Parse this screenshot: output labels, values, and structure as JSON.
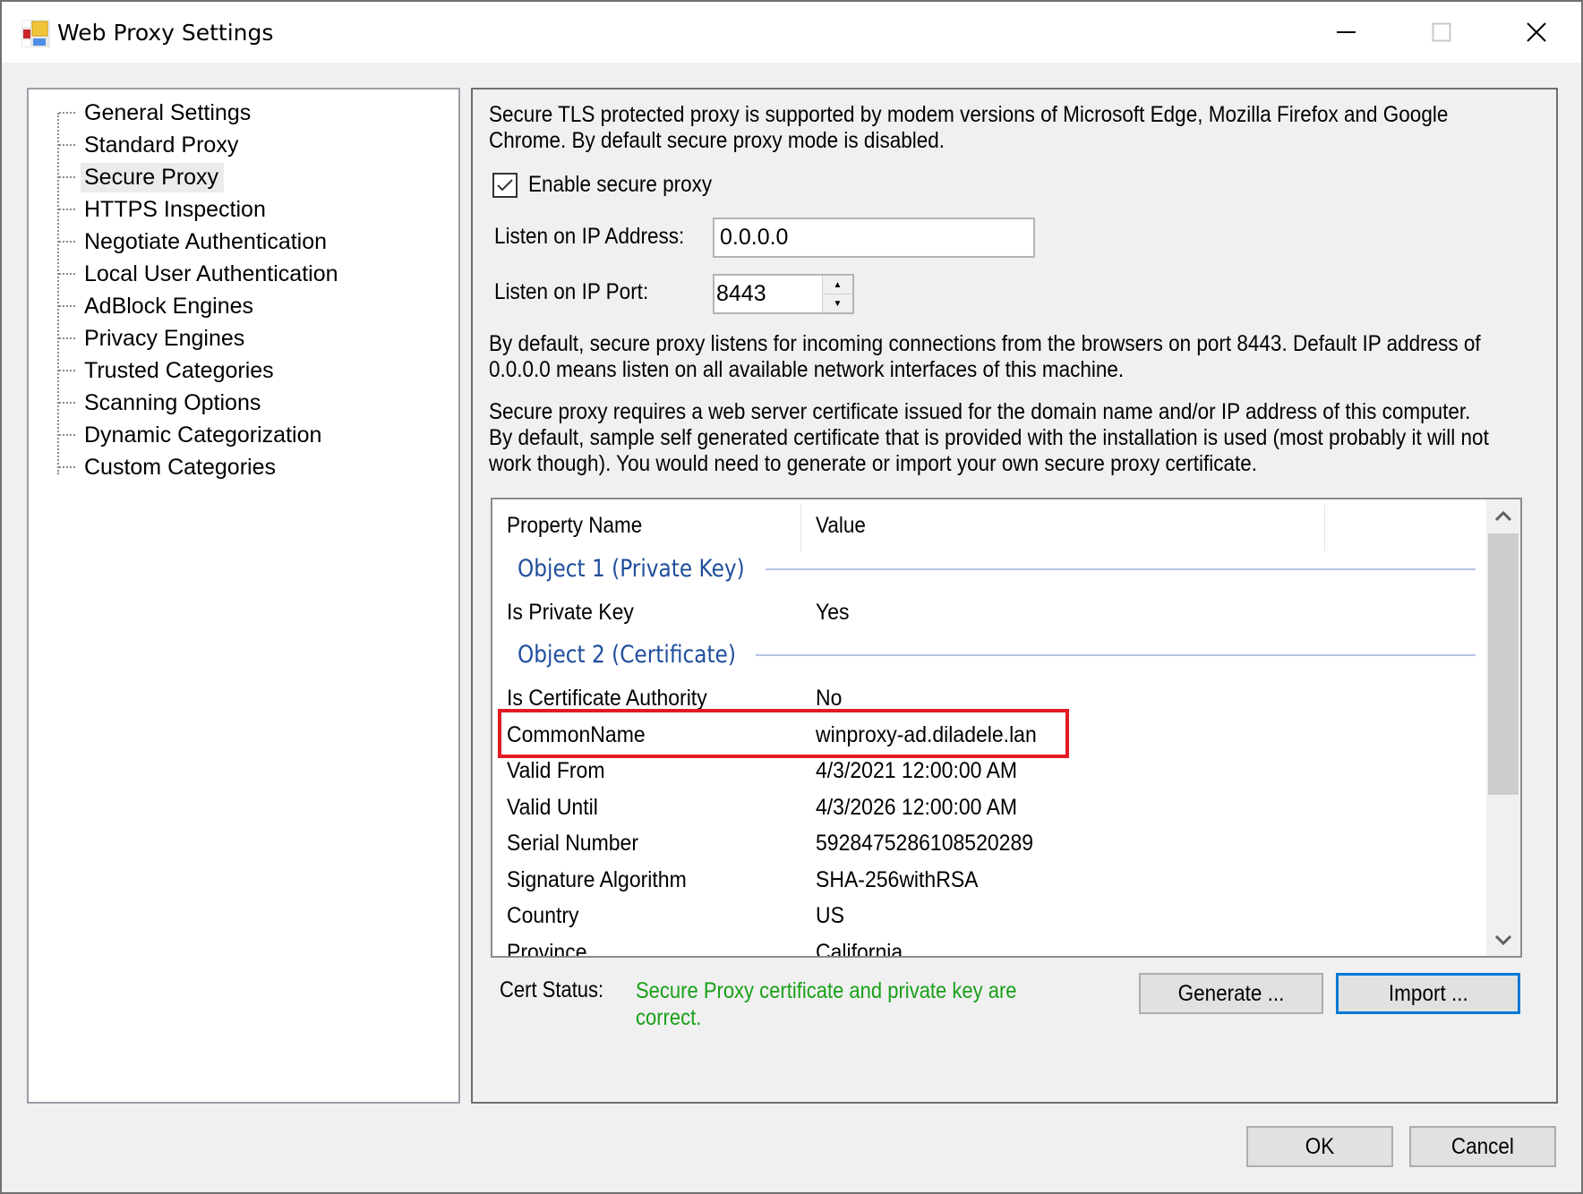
{
  "window": {
    "title": "Web Proxy Settings",
    "icon": "app-settings-icon",
    "controls": {
      "minimize": "minimize-icon",
      "maximize": "maximize-icon",
      "close": "close-icon"
    }
  },
  "sidebar": {
    "selected": "Secure Proxy",
    "items": [
      {
        "label": "General Settings"
      },
      {
        "label": "Standard Proxy"
      },
      {
        "label": "Secure Proxy"
      },
      {
        "label": "HTTPS Inspection"
      },
      {
        "label": "Negotiate Authentication"
      },
      {
        "label": "Local User Authentication"
      },
      {
        "label": "AdBlock Engines"
      },
      {
        "label": "Privacy Engines"
      },
      {
        "label": "Trusted Categories"
      },
      {
        "label": "Scanning Options"
      },
      {
        "label": "Dynamic Categorization"
      },
      {
        "label": "Custom Categories"
      }
    ]
  },
  "main": {
    "intro": [
      "Secure TLS protected proxy is supported by modem versions of Microsoft Edge, Mozilla Firefox and Google",
      "Chrome. By default secure proxy mode is disabled."
    ],
    "enable_checkbox": {
      "label": "Enable secure proxy",
      "checked": true
    },
    "ip_address": {
      "label": "Listen on IP Address:",
      "value": "0.0.0.0"
    },
    "ip_port": {
      "label": "Listen on IP Port:",
      "value": "8443"
    },
    "port_info": [
      "By default, secure proxy listens for incoming connections from the browsers on port 8443. Default IP address of",
      "0.0.0.0 means listen on all available network interfaces of this machine."
    ],
    "cert_info": [
      "Secure proxy requires a web server certificate issued for the domain name and/or IP address of this computer.",
      "By default, sample self generated certificate that is provided with the installation is used (most probably it will not",
      "work though). You would need to generate or import your own secure proxy certificate."
    ],
    "properties": {
      "columns": [
        "Property Name",
        "Value"
      ],
      "groups": [
        {
          "title": "Object 1 (Private Key)",
          "rows": [
            {
              "name": "Is Private Key",
              "value": "Yes"
            }
          ]
        },
        {
          "title": "Object 2 (Certificate)",
          "rows": [
            {
              "name": "Is Certificate Authority",
              "value": "No"
            },
            {
              "name": "CommonName",
              "value": "winproxy-ad.diladele.lan",
              "highlighted": true
            },
            {
              "name": "Valid From",
              "value": "4/3/2021 12:00:00 AM"
            },
            {
              "name": "Valid Until",
              "value": "4/3/2026 12:00:00 AM"
            },
            {
              "name": "Serial Number",
              "value": "5928475286108520289"
            },
            {
              "name": "Signature Algorithm",
              "value": "SHA-256withRSA"
            },
            {
              "name": "Country",
              "value": "US"
            },
            {
              "name": "Province",
              "value": "California"
            }
          ]
        }
      ]
    },
    "cert_status": {
      "label": "Cert Status:",
      "text": "Secure Proxy certificate and private key are correct.",
      "color": "#18a018"
    },
    "buttons": {
      "generate": "Generate ...",
      "import": "Import ..."
    }
  },
  "footer": {
    "ok": "OK",
    "cancel": "Cancel"
  },
  "colors": {
    "highlight_border": "#e21b23",
    "group_title": "#1f4e9c",
    "focus_border": "#0078d7"
  }
}
